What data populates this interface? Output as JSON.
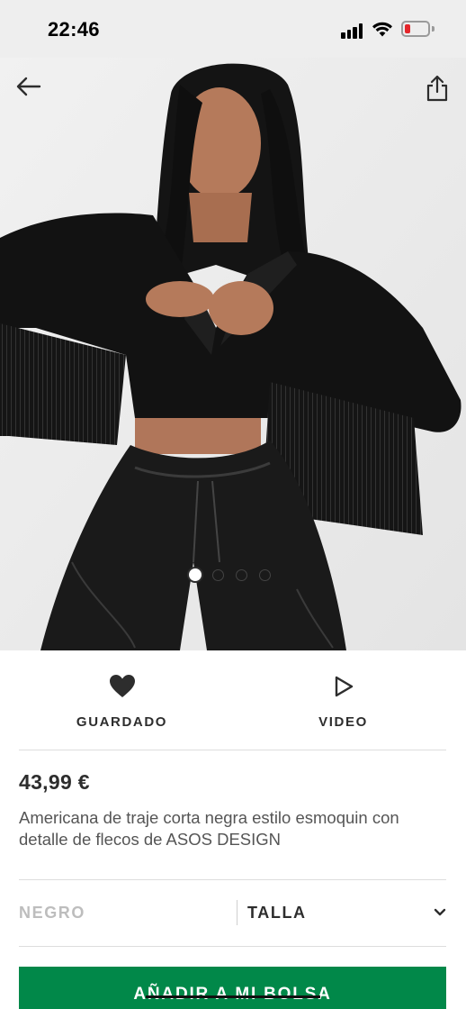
{
  "status_bar": {
    "time": "22:46",
    "icons": [
      "cellular-signal-icon",
      "wifi-icon",
      "battery-low-icon"
    ],
    "battery_color": "#e4262b"
  },
  "nav": {
    "back_icon": "arrow-left-icon",
    "share_icon": "share-icon"
  },
  "gallery": {
    "image_count": 4,
    "active_index": 0
  },
  "actions": {
    "saved": {
      "label": "GUARDADO",
      "icon": "heart-filled-icon"
    },
    "video": {
      "label": "VIDEO",
      "icon": "play-icon"
    }
  },
  "product": {
    "price": "43,99 €",
    "description": "Americana de traje corta negra estilo esmoquin con detalle de flecos de ASOS DESIGN"
  },
  "selectors": {
    "color": "NEGRO",
    "size": "TALLA",
    "size_icon": "chevron-down-icon"
  },
  "add_to_bag": {
    "label": "AÑADIR A MI BOLSA",
    "color": "#018849"
  }
}
